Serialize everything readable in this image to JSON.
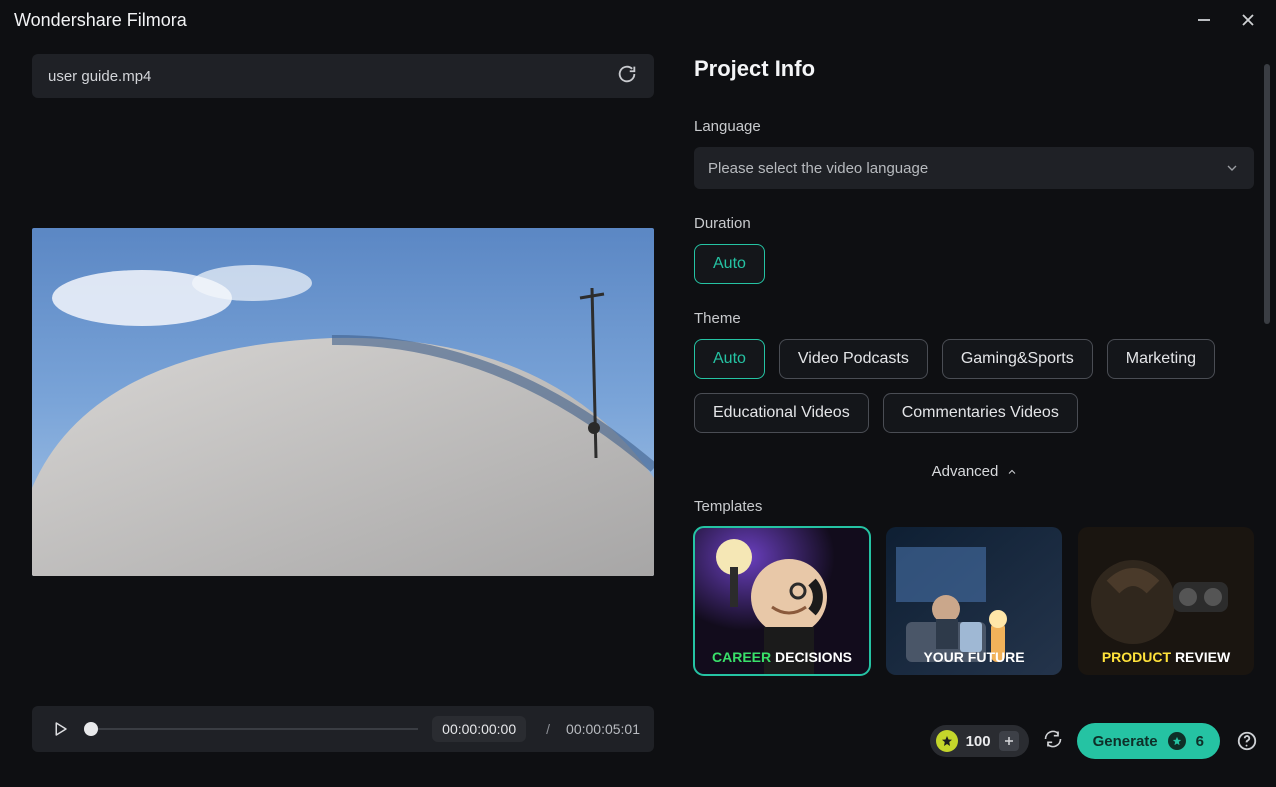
{
  "window": {
    "title": "Wondershare Filmora"
  },
  "left": {
    "file_name": "user guide.mp4",
    "time_current": "00:00:00:00",
    "time_total": "00:00:05:01"
  },
  "panel": {
    "heading": "Project Info",
    "language": {
      "label": "Language",
      "placeholder": "Please select the video language"
    },
    "duration": {
      "label": "Duration",
      "options": [
        "Auto"
      ],
      "selected": 0
    },
    "theme": {
      "label": "Theme",
      "options": [
        "Auto",
        "Video Podcasts",
        "Gaming&Sports",
        "Marketing",
        "Educational Videos",
        "Commentaries Videos"
      ],
      "selected": 0
    },
    "advanced_label": "Advanced",
    "templates": {
      "label": "Templates",
      "selected": 0,
      "items": [
        {
          "caption_a": "CAREER",
          "caption_b": "DECISIONS",
          "color_a": "#39e06a",
          "color_b": "#ffffff"
        },
        {
          "caption_a": "YOUR FUTURE",
          "caption_b": "",
          "color_a": "#ffffff",
          "color_b": "#ffffff"
        },
        {
          "caption_a": "PRODUCT",
          "caption_b": "REVIEW",
          "color_a": "#ffe23b",
          "color_b": "#ffffff"
        }
      ]
    }
  },
  "footer": {
    "credits": "100",
    "generate_label": "Generate",
    "generate_cost": "6"
  }
}
